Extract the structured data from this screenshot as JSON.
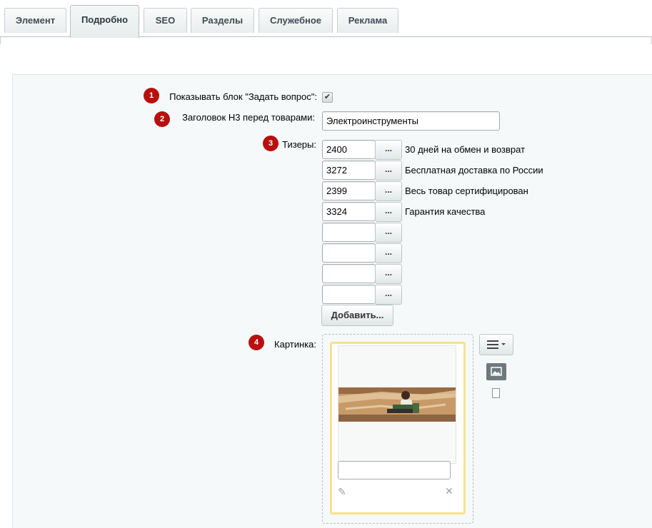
{
  "tabs": [
    {
      "label": "Элемент"
    },
    {
      "label": "Подробно"
    },
    {
      "label": "SEO"
    },
    {
      "label": "Разделы"
    },
    {
      "label": "Служебное"
    },
    {
      "label": "Реклама"
    }
  ],
  "active_tab": "Подробно",
  "form": {
    "field1": {
      "badge": "1",
      "label": "Показывать блок \"Задать вопрос\":",
      "checked": true
    },
    "field2": {
      "badge": "2",
      "label": "Заголовок H3 перед товарами:",
      "value": "Электроинструменты"
    },
    "field3": {
      "badge": "3",
      "label": "Тизеры:",
      "dots_label": "...",
      "rows": [
        {
          "value": "2400",
          "desc": "30 дней на обмен и возврат"
        },
        {
          "value": "3272",
          "desc": "Бесплатная доставка по России"
        },
        {
          "value": "2399",
          "desc": "Весь товар сертифицирован"
        },
        {
          "value": "3324",
          "desc": "Гарантия качества"
        },
        {
          "value": "",
          "desc": ""
        },
        {
          "value": "",
          "desc": ""
        },
        {
          "value": "",
          "desc": ""
        },
        {
          "value": "",
          "desc": ""
        }
      ],
      "add_label": "Добавить..."
    },
    "field4": {
      "badge": "4",
      "label": "Картинка:",
      "caption_value": ""
    }
  },
  "icons": {
    "checkbox": "checkmark-icon",
    "edit": "pencil-icon",
    "delete": "close-icon",
    "menu": "hamburger-menu-icon",
    "image": "image-icon",
    "file": "file-icon"
  },
  "colors": {
    "badge": "#b80f0f",
    "panel_bg": "#f5f9f9",
    "card_border": "#f6e28a"
  }
}
